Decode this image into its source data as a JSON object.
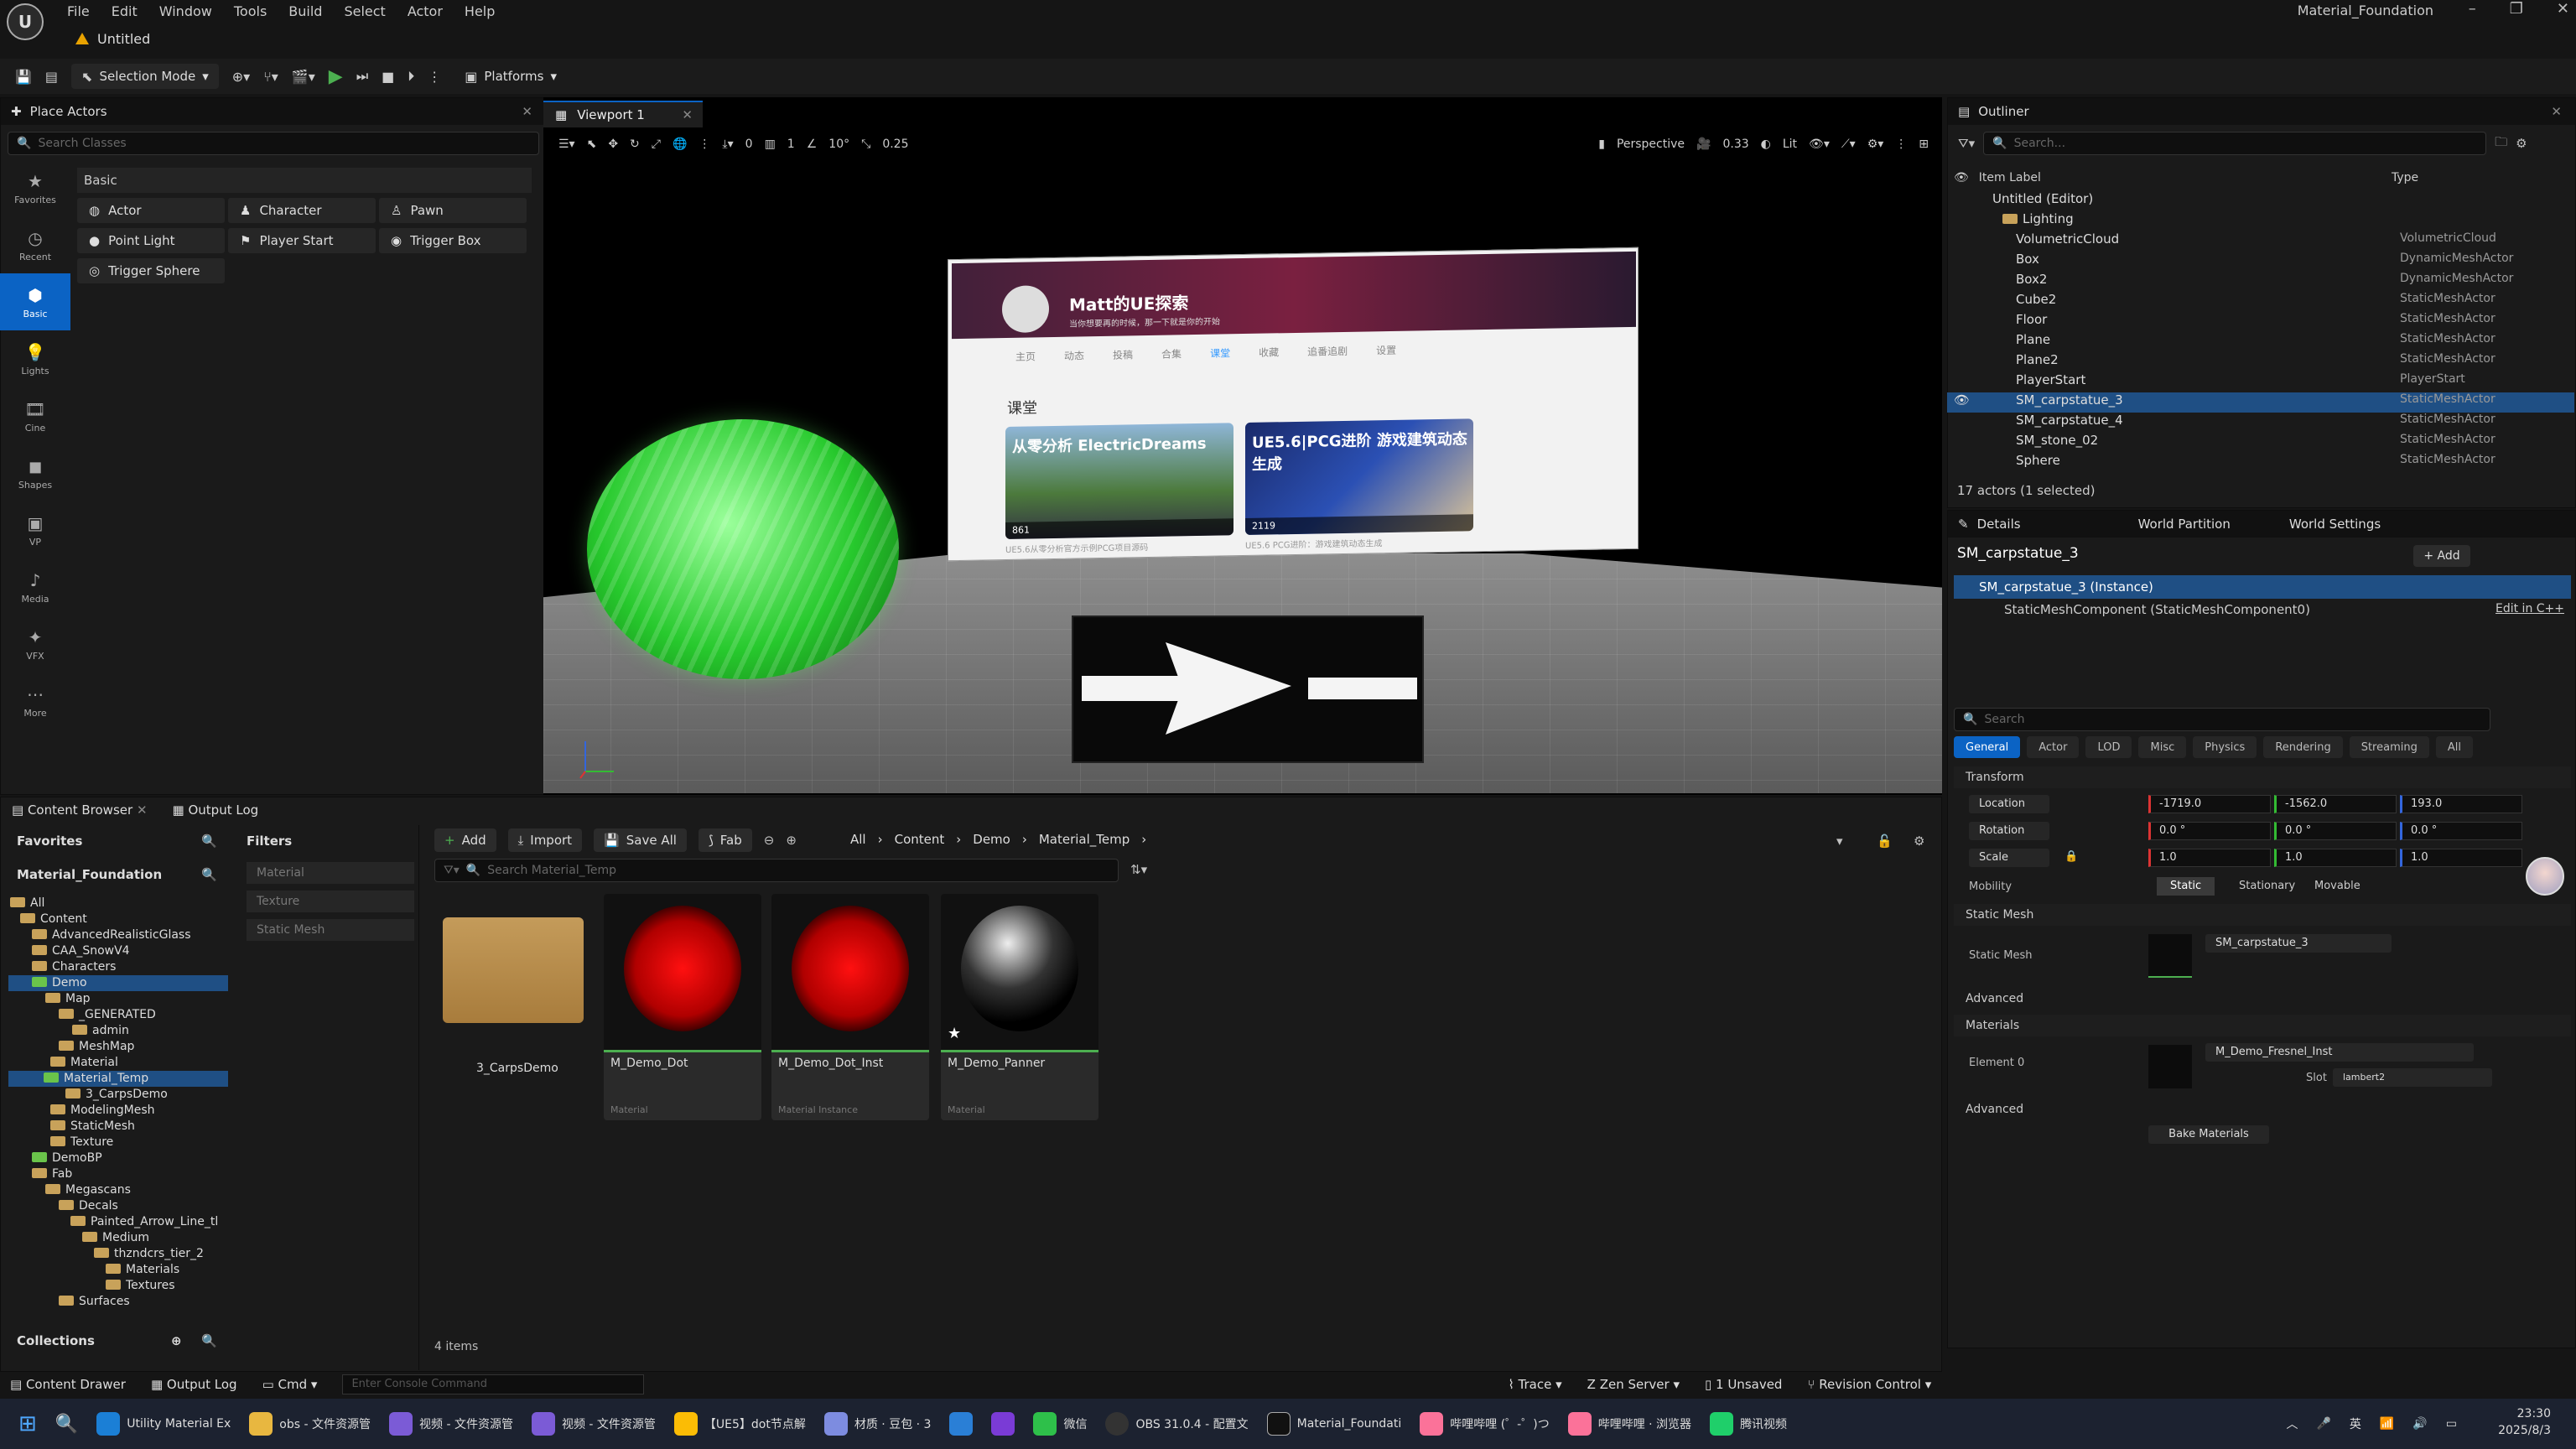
{
  "menu": [
    "File",
    "Edit",
    "Window",
    "Tools",
    "Build",
    "Select",
    "Actor",
    "Help"
  ],
  "project_name": "Material_Foundation",
  "doc_tab": "Untitled",
  "toolbar": {
    "selection_mode": "Selection Mode",
    "platforms": "Platforms"
  },
  "place_actors": {
    "tab": "Place Actors",
    "search_placeholder": "Search Classes",
    "section": "Basic",
    "categories": [
      "Favorites",
      "Recent",
      "Basic",
      "Lights",
      "Cine",
      "Shapes",
      "VP",
      "Media",
      "VFX",
      "More"
    ],
    "items": [
      "Actor",
      "Character",
      "Pawn",
      "Point Light",
      "Player Start",
      "Trigger Box",
      "Trigger Sphere"
    ]
  },
  "viewport": {
    "tab": "Viewport 1",
    "snap_translate": "0",
    "snap_grid": "1",
    "snap_rotate": "10°",
    "snap_scale": "0.25",
    "view_mode_persp": "Perspective",
    "camera_speed": "0.33",
    "lit": "Lit"
  },
  "scene": {
    "board_title": "Matt的UE探索",
    "board_sub": "当你想要再的时候，那一下就是你的开始",
    "board_tabs": [
      "主页",
      "动态",
      "投稿",
      "合集",
      "课堂",
      "收藏",
      "追番追剧",
      "设置"
    ],
    "board_section": "课堂",
    "card1_caption": "从零分析 ElectricDreams",
    "card1_foot": "861",
    "card1_sub": "UE5.6从零分析官方示例PCG项目源码",
    "card2_caption": "UE5.6|PCG进阶 游戏建筑动态生成",
    "card2_foot": "2119",
    "card2_sub": "UE5.6 PCG进阶：游戏建筑动态生成"
  },
  "outliner": {
    "tab": "Outliner",
    "search_placeholder": "Search...",
    "col_label": "Item Label",
    "col_type": "Type",
    "rows": [
      {
        "label": "Untitled (Editor)",
        "type": ""
      },
      {
        "label": "Lighting",
        "type": ""
      },
      {
        "label": "VolumetricCloud",
        "type": "VolumetricCloud"
      },
      {
        "label": "Box",
        "type": "DynamicMeshActor"
      },
      {
        "label": "Box2",
        "type": "DynamicMeshActor"
      },
      {
        "label": "Cube2",
        "type": "StaticMeshActor"
      },
      {
        "label": "Floor",
        "type": "StaticMeshActor"
      },
      {
        "label": "Plane",
        "type": "StaticMeshActor"
      },
      {
        "label": "Plane2",
        "type": "StaticMeshActor"
      },
      {
        "label": "PlayerStart",
        "type": "PlayerStart"
      },
      {
        "label": "SM_carpstatue_3",
        "type": "StaticMeshActor"
      },
      {
        "label": "SM_carpstatue_4",
        "type": "StaticMeshActor"
      },
      {
        "label": "SM_stone_02",
        "type": "StaticMeshActor"
      },
      {
        "label": "Sphere",
        "type": "StaticMeshActor"
      }
    ],
    "count": "17 actors (1 selected)"
  },
  "details": {
    "tab": "Details",
    "tab2": "World Partition",
    "tab3": "World Settings",
    "actor": "SM_carpstatue_3",
    "add": "Add",
    "instance": "SM_carpstatue_3 (Instance)",
    "component": "StaticMeshComponent (StaticMeshComponent0)",
    "edit_cpp": "Edit in C++",
    "search_placeholder": "Search",
    "filters": [
      "General",
      "Actor",
      "LOD",
      "Misc",
      "Physics",
      "Rendering",
      "Streaming",
      "All"
    ],
    "transform": "Transform",
    "location": "Location",
    "rotation": "Rotation",
    "scale": "Scale",
    "loc": [
      "-1719.0",
      "-1562.0",
      "193.0"
    ],
    "rot": [
      "0.0 °",
      "0.0 °",
      "0.0 °"
    ],
    "scl": [
      "1.0",
      "1.0",
      "1.0"
    ],
    "mobility": "Mobility",
    "mob_opts": [
      "Static",
      "Stationary",
      "Movable"
    ],
    "static_mesh_sec": "Static Mesh",
    "static_mesh_lbl": "Static Mesh",
    "static_mesh_val": "SM_carpstatue_3",
    "advanced": "Advanced",
    "materials_sec": "Materials",
    "element0": "Element 0",
    "material_val": "M_Demo_Fresnel_Inst",
    "slot_lbl": "Slot",
    "slot_val": "lambert2",
    "bake": "Bake Materials"
  },
  "content_browser": {
    "tab": "Content Browser",
    "tab2": "Output Log",
    "favorites": "Favorites",
    "root": "Material_Foundation",
    "filters_title": "Filters",
    "filter_items": [
      "Material",
      "Texture",
      "Static Mesh"
    ],
    "add": "Add",
    "import": "Import",
    "save_all": "Save All",
    "fab": "Fab",
    "breadcrumb": [
      "All",
      "Content",
      "Demo",
      "Material_Temp"
    ],
    "search_placeholder": "Search Material_Temp",
    "tree": [
      "All",
      "Content",
      "AdvancedRealisticGlass",
      "CAA_SnowV4",
      "Characters",
      "Demo",
      "Map",
      "_GENERATED",
      "admin",
      "MeshMap",
      "Material",
      "Material_Temp",
      "3_CarpsDemo",
      "ModelingMesh",
      "StaticMesh",
      "Texture",
      "DemoBP",
      "Fab",
      "Megascans",
      "Decals",
      "Painted_Arrow_Line_tl",
      "Medium",
      "thzndcrs_tier_2",
      "Materials",
      "Textures",
      "Surfaces"
    ],
    "assets": [
      {
        "name": "3_CarpsDemo",
        "type": ""
      },
      {
        "name": "M_Demo_Dot",
        "type": "Material"
      },
      {
        "name": "M_Demo_Dot_Inst",
        "type": "Material Instance"
      },
      {
        "name": "M_Demo_Panner",
        "type": "Material"
      }
    ],
    "count": "4 items",
    "collections": "Collections"
  },
  "bottom": {
    "drawer": "Content Drawer",
    "log": "Output Log",
    "cmd": "Cmd",
    "console_placeholder": "Enter Console Command",
    "trace": "Trace",
    "zen": "Zen Server",
    "unsaved": "1 Unsaved",
    "revision": "Revision Control"
  },
  "taskbar": {
    "apps": [
      "Utility Material Ex",
      "obs - 文件资源管",
      "视频 - 文件资源管",
      "视频 - 文件资源管",
      "【UE5】dot节点解",
      "材质 · 豆包 · 3",
      "微信",
      "OBS 31.0.4 - 配置文",
      "Material_Foundati",
      "哔哩哔哩 (゜-゜)つ",
      "哔哩哔哩 · 浏览器",
      "腾讯视频"
    ],
    "time": "23:30",
    "date": "2025/8/3",
    "ime": "英"
  }
}
